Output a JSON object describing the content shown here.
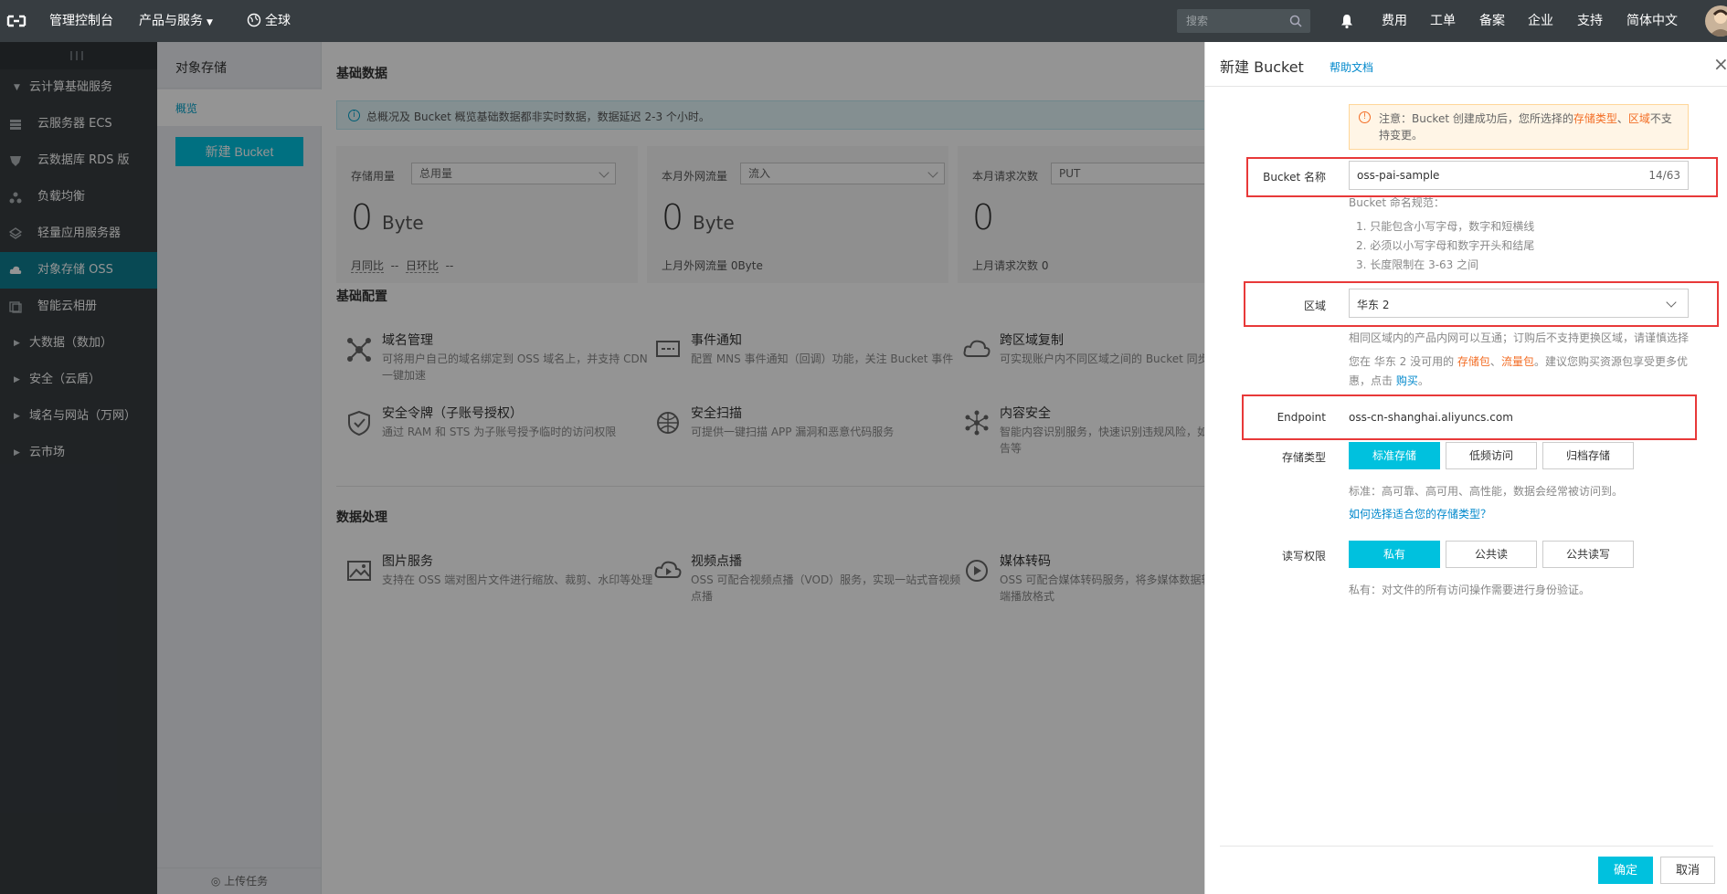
{
  "topbar": {
    "console": "管理控制台",
    "products": "产品与服务",
    "region": "全球",
    "search_placeholder": "搜索",
    "links": [
      "费用",
      "工单",
      "备案",
      "企业",
      "支持",
      "简体中文"
    ]
  },
  "sidebar": {
    "group_main": "云计算基础服务",
    "items": [
      "云服务器 ECS",
      "云数据库 RDS 版",
      "负载均衡",
      "轻量应用服务器",
      "对象存储 OSS",
      "智能云相册"
    ],
    "groups": [
      "大数据（数加）",
      "安全（云盾）",
      "域名与网站（万网）",
      "云市场"
    ]
  },
  "subside": {
    "title": "对象存储",
    "nav_overview": "概览",
    "new_bucket": "新建 Bucket",
    "upload_tasks": "上传任务"
  },
  "main": {
    "basic_data": "基础数据",
    "info": "总概况及 Bucket 概览基础数据都非实时数据，数据延迟 2-3 个小时。",
    "storage": {
      "label": "存储用量",
      "select": "总用量",
      "value": "0",
      "unit": "Byte",
      "foot_a": "月同比",
      "foot_b": "--",
      "foot_c": "日环比",
      "foot_d": "--"
    },
    "traffic": {
      "label": "本月外网流量",
      "select": "流入",
      "value": "0",
      "unit": "Byte",
      "foot": "上月外网流量  0Byte"
    },
    "requests": {
      "label": "本月请求次数",
      "select": "PUT",
      "value": "0",
      "foot": "上月请求次数  0"
    },
    "basic_config": "基础配置",
    "config": [
      {
        "title": "域名管理",
        "desc": "可将用户自己的域名绑定到 OSS 域名上，并支持 CDN 一键加速"
      },
      {
        "title": "事件通知",
        "desc": "配置 MNS 事件通知（回调）功能，关注 Bucket 事件"
      },
      {
        "title": "跨区域复制",
        "desc": "可实现账户内不同区域之间的 Bucket 同步"
      },
      {
        "title": "安全令牌（子账号授权）",
        "desc": "通过 RAM 和 STS 为子账号授予临时的访问权限"
      },
      {
        "title": "安全扫描",
        "desc": "可提供一键扫描 APP 漏洞和恶意代码服务"
      },
      {
        "title": "内容安全",
        "desc": "智能内容识别服务，快速识别违规风险，如色情、垃圾广告等"
      }
    ],
    "data_processing": "数据处理",
    "processing": [
      {
        "title": "图片服务",
        "desc": "支持在 OSS 端对图片文件进行缩放、裁剪、水印等处理"
      },
      {
        "title": "视频点播",
        "desc": "OSS 可配合视频点播（VOD）服务，实现一站式音视频点播"
      },
      {
        "title": "媒体转码",
        "desc": "OSS 可配合媒体转码服务，将多媒体数据转换成多种终端播放格式"
      }
    ]
  },
  "drawer": {
    "title": "新建 Bucket",
    "help": "帮助文档",
    "close": "×",
    "warn_a": "注意：Bucket 创建成功后，您所选择的",
    "warn_b": "存储类型",
    "warn_c": "、",
    "warn_d": "区域",
    "warn_e": "不支持变更。",
    "name_label": "Bucket 名称",
    "name_value": "oss-pai-sample",
    "name_count": "14/63",
    "naming_title": "Bucket 命名规范：",
    "naming_rules": [
      "1. 只能包含小写字母，数字和短横线",
      "2. 必须以小写字母和数字开头和结尾",
      "3. 长度限制在 3-63 之间"
    ],
    "region_label": "区域",
    "region_value": "华东 2",
    "region_hint": "相同区域内的产品内网可以互通；订购后不支持更换区域，请谨慎选择",
    "region_pkg_a": "您在 华东 2 没可用的 ",
    "region_pkg_b": "存储包",
    "region_pkg_c": "、",
    "region_pkg_d": "流量包",
    "region_pkg_e": "。建议您购买资源包享受更多优",
    "region_pkg_f": "惠，点击 ",
    "region_pkg_g": "购买",
    "region_pkg_h": "。",
    "endpoint_label": "Endpoint",
    "endpoint_value": "oss-cn-shanghai.aliyuncs.com",
    "storage_label": "存储类型",
    "storage_options": [
      "标准存储",
      "低频访问",
      "归档存储"
    ],
    "storage_hint": "标准：高可靠、高可用、高性能，数据会经常被访问到。",
    "storage_link": "如何选择适合您的存储类型？",
    "acl_label": "读写权限",
    "acl_options": [
      "私有",
      "公共读",
      "公共读写"
    ],
    "acl_hint": "私有：对文件的所有访问操作需要进行身份验证。",
    "ok": "确定",
    "cancel": "取消"
  },
  "colors": {
    "accent": "#00c1de",
    "topbar": "#373d41",
    "warning": "#f36e26",
    "highlight_box": "#e83939"
  }
}
